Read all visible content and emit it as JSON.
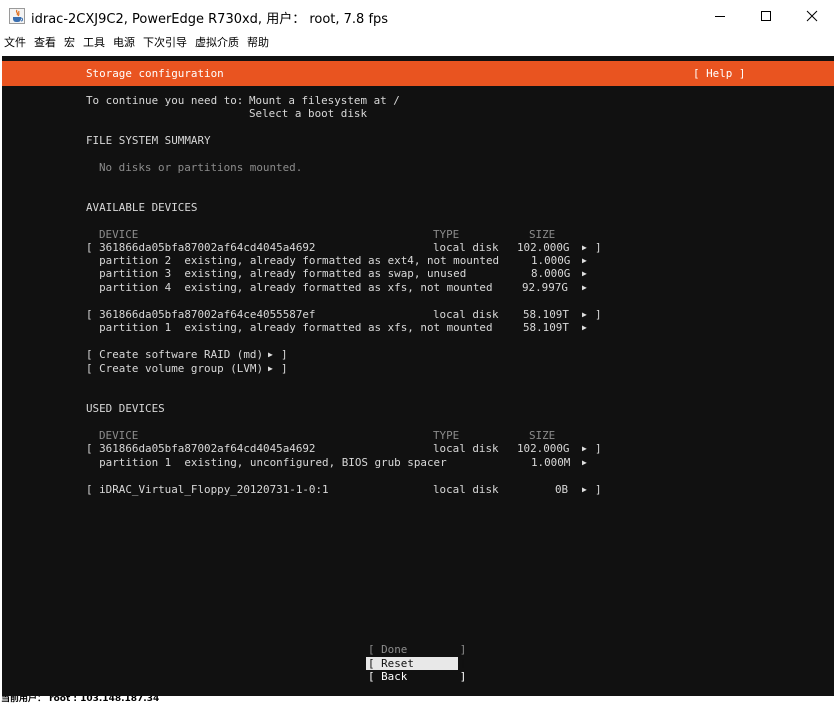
{
  "window": {
    "title": "idrac-2CXJ9C2, PowerEdge R730xd, 用户： root, 7.8 fps",
    "minimize_icon": "minimize-icon",
    "maximize_icon": "maximize-icon",
    "close_icon": "close-icon"
  },
  "menu": [
    "文件",
    "查看",
    "宏",
    "工具",
    "电源",
    "下次引导",
    "虚拟介质",
    "帮助"
  ],
  "installer": {
    "header_title": "Storage configuration",
    "help_label": "[ Help ]",
    "prompt_prefix": "To continue you need to:",
    "prompt_line1": "Mount a filesystem at /",
    "prompt_line2": "Select a boot disk",
    "fs_summary_heading": "FILE SYSTEM SUMMARY",
    "fs_summary_empty": "No disks or partitions mounted.",
    "available_heading": "AVAILABLE DEVICES",
    "col_device": "DEVICE",
    "col_type": "TYPE",
    "col_size": "SIZE",
    "available": [
      {
        "device": "[ 361866da05bfa87002af64cd4045a4692",
        "type": "local disk",
        "size": "102.000G",
        "tail": "]"
      },
      {
        "device": "  partition 2  existing, already formatted as ext4, not mounted",
        "type": "",
        "size": "1.000G",
        "tail": ""
      },
      {
        "device": "  partition 3  existing, already formatted as swap, unused",
        "type": "",
        "size": "8.000G",
        "tail": ""
      },
      {
        "device": "  partition 4  existing, already formatted as xfs, not mounted",
        "type": "",
        "size": "92.997G",
        "tail": ""
      },
      {
        "device": "[ 361866da05bfa87002af64ce4055587ef",
        "type": "local disk",
        "size": "58.109T",
        "tail": "]"
      },
      {
        "device": "  partition 1  existing, already formatted as xfs, not mounted",
        "type": "",
        "size": "58.109T",
        "tail": ""
      }
    ],
    "create_raid": "[ Create software RAID (md)",
    "create_lvm": "[ Create volume group (LVM)",
    "used_heading": "USED DEVICES",
    "used": [
      {
        "device": "[ 361866da05bfa87002af64cd4045a4692",
        "type": "local disk",
        "size": "102.000G",
        "tail": "]"
      },
      {
        "device": "  partition 1  existing, unconfigured, BIOS grub spacer",
        "type": "",
        "size": "1.000M",
        "tail": ""
      },
      {
        "device": "[ iDRAC_Virtual_Floppy_20120731-1-0:1",
        "type": "local disk",
        "size": "0B",
        "tail": "]"
      }
    ],
    "btn_done": "[ Done        ]",
    "btn_reset": "[ Reset       ]",
    "btn_back": "[ Back        ]"
  },
  "status": "当前用户： root : 103.148.187.34",
  "colors": {
    "accent": "#e95420",
    "console_bg": "#111111"
  }
}
